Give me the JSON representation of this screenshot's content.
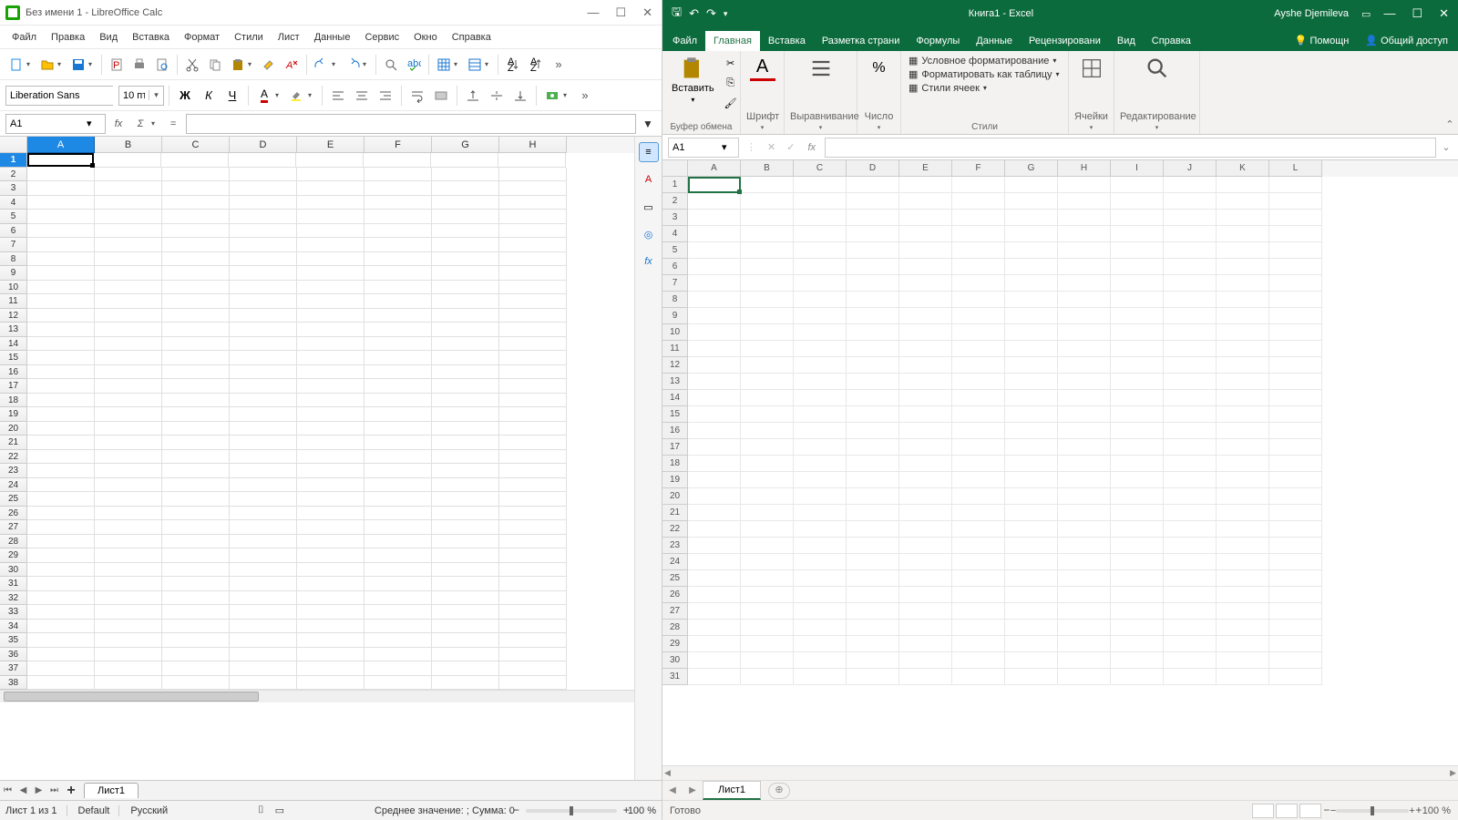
{
  "libre": {
    "title": "Без имени 1 - LibreOffice Calc",
    "menu": [
      "Файл",
      "Правка",
      "Вид",
      "Вставка",
      "Формат",
      "Стили",
      "Лист",
      "Данные",
      "Сервис",
      "Окно",
      "Справка"
    ],
    "font_name": "Liberation Sans",
    "font_size": "10 пт",
    "cell_ref": "A1",
    "columns": [
      "A",
      "B",
      "C",
      "D",
      "E",
      "F",
      "G",
      "H"
    ],
    "row_count": 38,
    "sheet_tab": "Лист1",
    "status": {
      "sheet_info": "Лист 1 из 1",
      "style": "Default",
      "lang": "Русский",
      "aggregate": "Среднее значение: ; Сумма: 0",
      "zoom": "100 %"
    }
  },
  "excel": {
    "doc_title": "Книга1  -  Excel",
    "user": "Ayshe Djemileva",
    "tabs": [
      "Файл",
      "Главная",
      "Вставка",
      "Разметка страни",
      "Формулы",
      "Данные",
      "Рецензировани",
      "Вид",
      "Справка"
    ],
    "help": "Помощн",
    "share": "Общий доступ",
    "groups": {
      "clipboard": {
        "paste": "Вставить",
        "label": "Буфер обмена"
      },
      "font": "Шрифт",
      "align": "Выравнивание",
      "number": "Число",
      "styles": "Стили",
      "cond": "Условное форматирование",
      "fmttbl": "Форматировать как таблицу",
      "cellst": "Стили ячеек",
      "cells": "Ячейки",
      "editing": "Редактирование"
    },
    "cell_ref": "A1",
    "columns": [
      "A",
      "B",
      "C",
      "D",
      "E",
      "F",
      "G",
      "H",
      "I",
      "J",
      "K",
      "L"
    ],
    "row_count": 31,
    "sheet_tab": "Лист1",
    "status_ready": "Готово",
    "zoom": "100 %"
  }
}
